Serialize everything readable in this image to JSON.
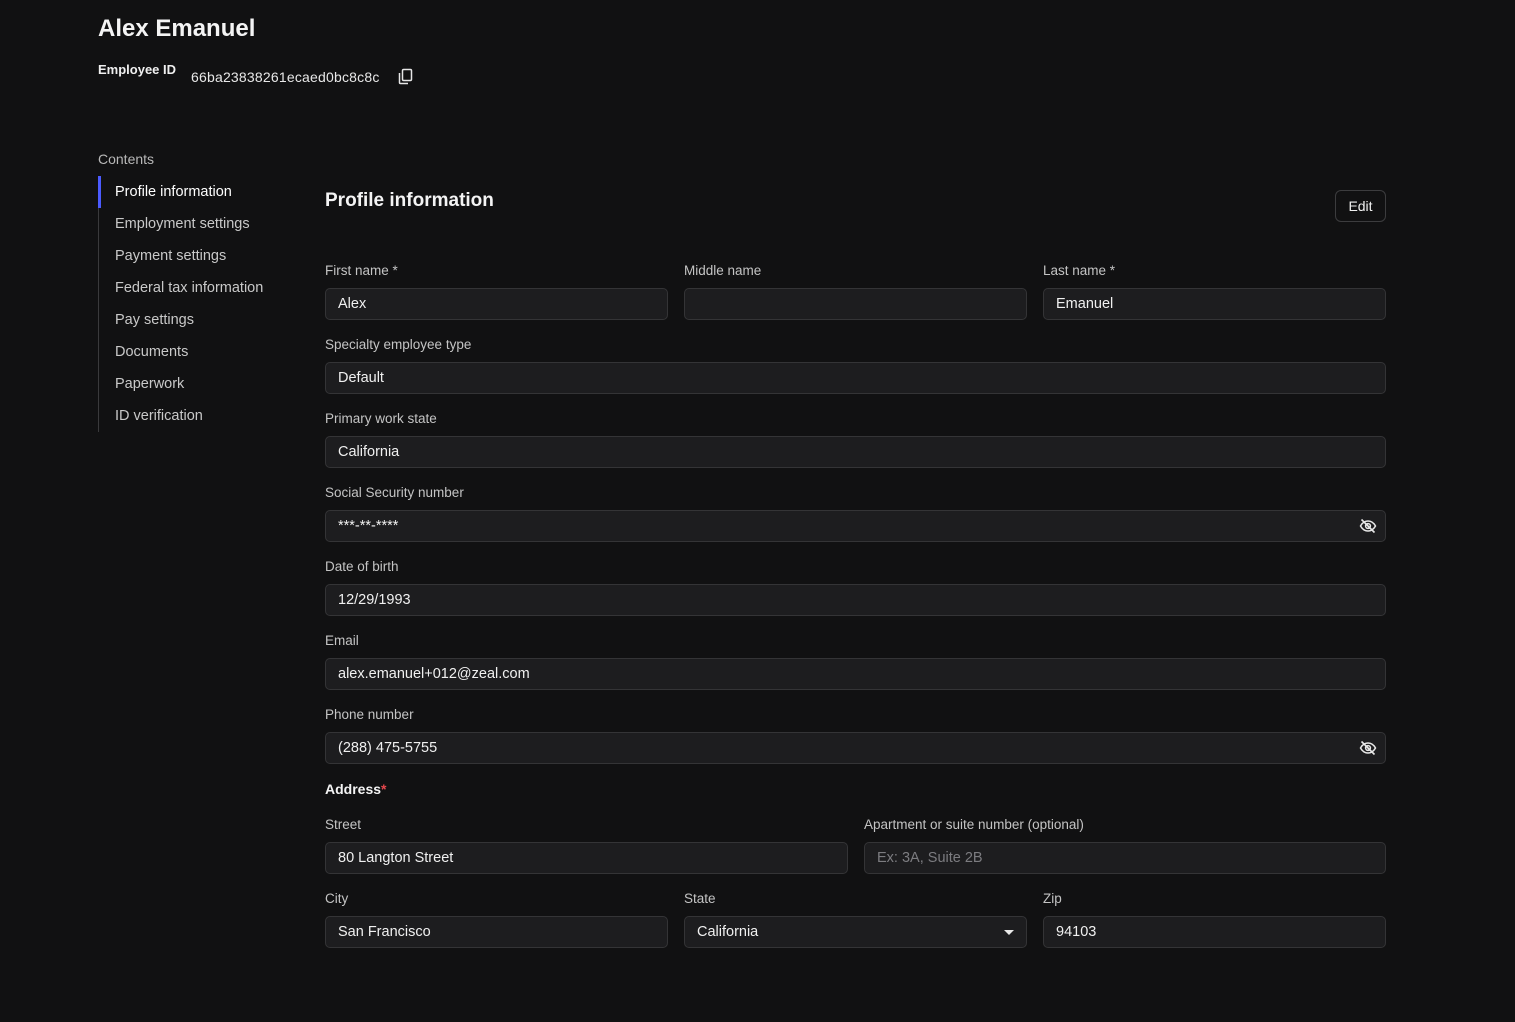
{
  "header": {
    "name": "Alex Emanuel",
    "employee_id_label": "Employee ID",
    "employee_id_value": "66ba23838261ecaed0bc8c8c",
    "copy_icon": "copy-icon"
  },
  "sidebar": {
    "heading": "Contents",
    "items": [
      {
        "label": "Profile information",
        "active": true
      },
      {
        "label": "Employment settings"
      },
      {
        "label": "Payment settings"
      },
      {
        "label": "Federal tax information"
      },
      {
        "label": "Pay settings"
      },
      {
        "label": "Documents"
      },
      {
        "label": "Paperwork"
      },
      {
        "label": "ID verification"
      }
    ]
  },
  "main": {
    "title": "Profile information",
    "edit_label": "Edit",
    "first_name": {
      "label": "First name *",
      "value": "Alex"
    },
    "middle_name": {
      "label": "Middle name",
      "value": ""
    },
    "last_name": {
      "label": "Last name *",
      "value": "Emanuel"
    },
    "specialty_type": {
      "label": "Specialty employee type",
      "value": "Default"
    },
    "work_state": {
      "label": "Primary work state",
      "value": "California"
    },
    "ssn": {
      "label": "Social Security number",
      "value": "***-**-****",
      "icon": "eye-off-icon"
    },
    "dob": {
      "label": "Date of birth",
      "value": "12/29/1993"
    },
    "email": {
      "label": "Email",
      "value": "alex.emanuel+012@zeal.com"
    },
    "phone": {
      "label": "Phone number",
      "value": "(288) 475-5755",
      "icon": "eye-off-icon"
    },
    "address": {
      "heading": "Address",
      "required_mark": "*",
      "street": {
        "label": "Street",
        "value": "80 Langton Street"
      },
      "apt": {
        "label": "Apartment or suite number (optional)",
        "value": "",
        "placeholder": "Ex: 3A, Suite 2B"
      },
      "city": {
        "label": "City",
        "value": "San Francisco"
      },
      "state": {
        "label": "State",
        "value": "California"
      },
      "zip": {
        "label": "Zip",
        "value": "94103"
      }
    }
  },
  "colors": {
    "background": "#111112",
    "field_bg": "#1d1d1f",
    "accent": "#4b5bff",
    "required": "#e5484d"
  }
}
